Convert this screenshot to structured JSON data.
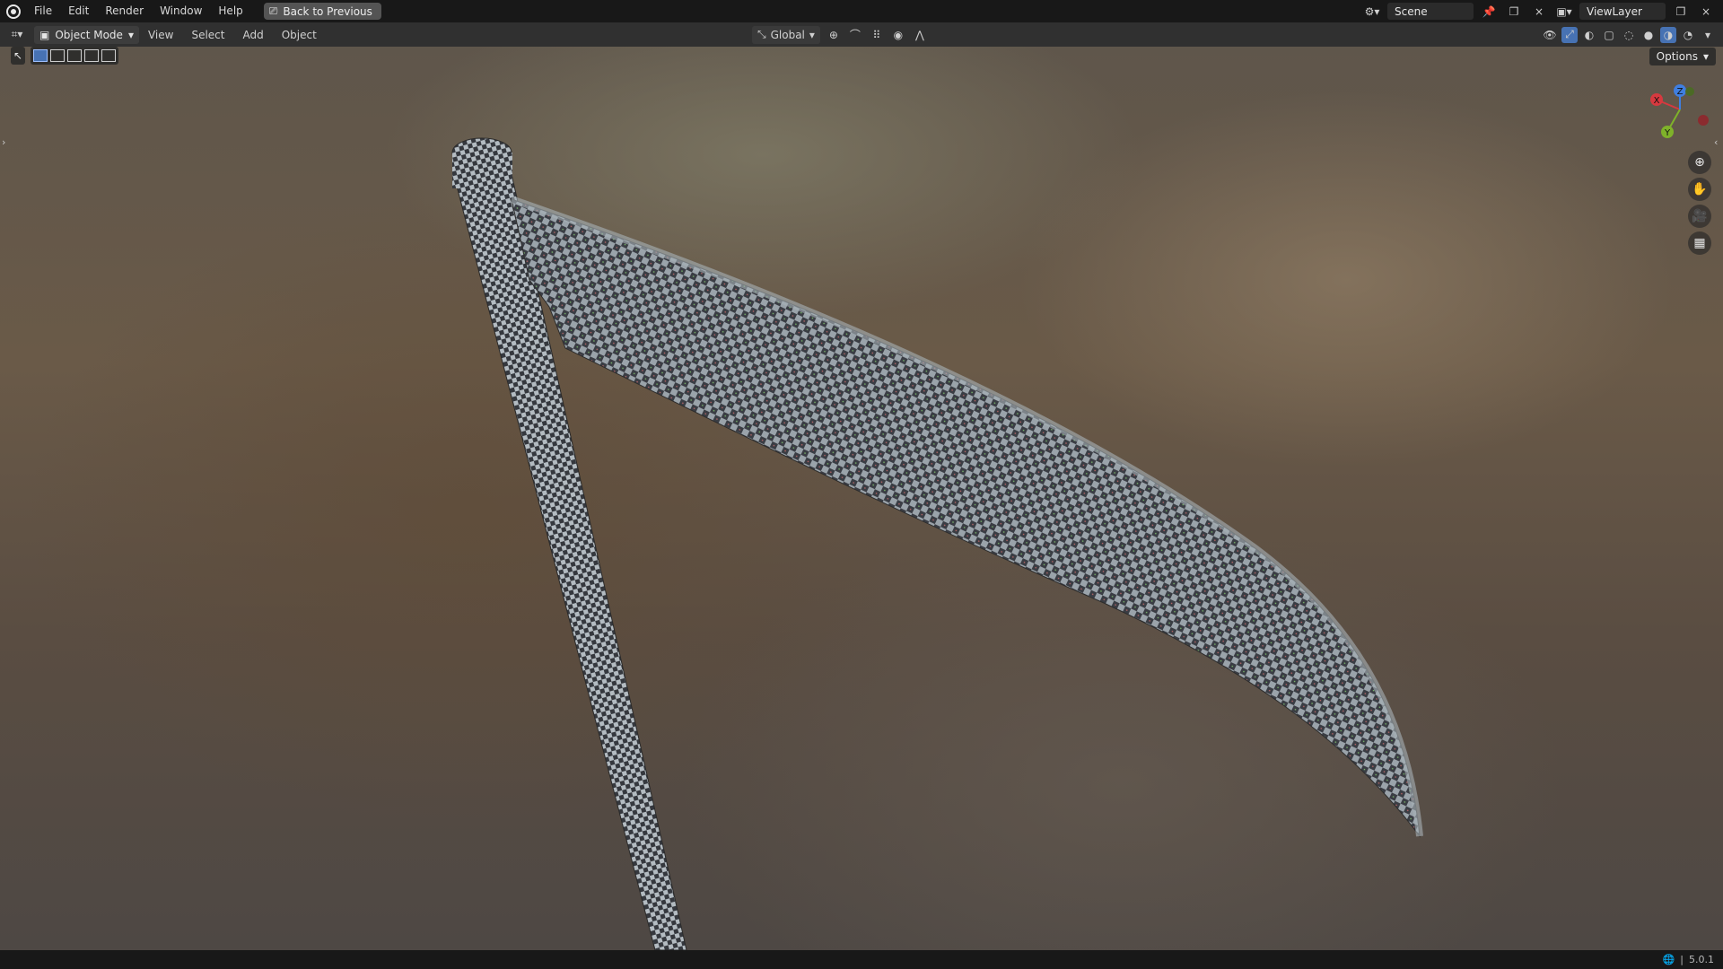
{
  "topbar": {
    "menus": [
      "File",
      "Edit",
      "Render",
      "Window",
      "Help"
    ],
    "back_button": "Back to Previous",
    "scene_name": "Scene",
    "view_layer_name": "ViewLayer"
  },
  "header": {
    "mode": "Object Mode",
    "menus": [
      "View",
      "Select",
      "Add",
      "Object"
    ],
    "transform_orientation": "Global"
  },
  "viewport": {
    "options_label": "Options",
    "gizmo_axes": [
      "X",
      "Y",
      "Z"
    ],
    "object_texture": "checker",
    "colors": {
      "axis_x": "#d6393f",
      "axis_y": "#7fb22a",
      "axis_z": "#3f7ee0"
    }
  },
  "statusbar": {
    "version": "5.0.1"
  }
}
